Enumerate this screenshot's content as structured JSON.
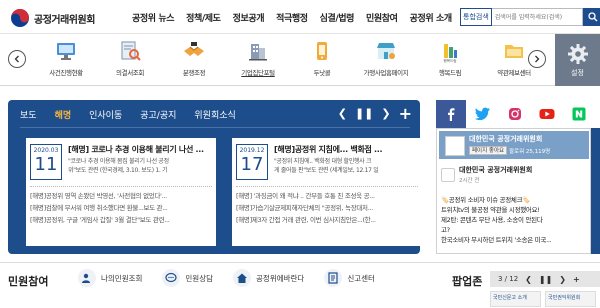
{
  "header": {
    "logo_text": "공정거래위원회",
    "nav": [
      "공정위 뉴스",
      "정책/제도",
      "정보공개",
      "적극행정",
      "심결/법령",
      "민원참여",
      "공정위 소개"
    ],
    "search_scope": "통합검색",
    "search_placeholder": "검색어를 입력하세요(검색)"
  },
  "quick_menu": {
    "items": [
      {
        "label": "사건진행현황",
        "icon": "monitor-icon"
      },
      {
        "label": "의결서조회",
        "icon": "document-search-icon"
      },
      {
        "label": "분쟁조정",
        "icon": "handshake-icon"
      },
      {
        "label": "기업집단포털",
        "icon": "building-icon"
      },
      {
        "label": "두낫콜",
        "icon": "phone-block-icon"
      },
      {
        "label": "가맹사업홈페이지",
        "icon": "shop-icon"
      },
      {
        "label": "행복드림",
        "icon": "happy-dream-icon"
      },
      {
        "label": "약관제보센터",
        "icon": "folder-icon"
      }
    ],
    "settings_label": "설정"
  },
  "board": {
    "tabs": [
      "보도",
      "해명",
      "인사이동",
      "공고/공지",
      "위원회소식"
    ],
    "active_tab": "해명",
    "cards": [
      {
        "ym": "2020.03",
        "day": "11",
        "title": "[해명] 코로나 추경 이용해 불리기 나선 ...",
        "desc1": "\"코로나 추경 이용해 몸집 불리기 나선 공정",
        "desc2": "위\"보도 관련 (한국경제, 3.10. 보도) 1. 기",
        "list": [
          "[해명]공정위 영역 손봤던 박영선, '사전협의 없었다'...",
          "[해명]검찰에 무서워 여행 취소했다면 환불...보도 관...",
          "[해명]공정위, 구글 '게임사 갑질' 3월 결단\"보도 관련..."
        ]
      },
      {
        "ym": "2019.12",
        "day": "17",
        "title": "[해명]공정위 지침에... 백화점 ...",
        "desc1": "\"공정위 지침에.. 백화점 대형 할인행사 크",
        "desc2": "게 줄어들 판\"보도 관련 (세계일보, 12.17 일",
        "list": [
          "[해명] '과징금이 왜 적냐 .. 간부들 호통 친 조성욱 공...",
          "[해명]가습기살균제피해자단체의 \"공정위, 녹장대처...",
          "[해명]제3자 간접 거래 관련, 이번 심사지침안은...(한..."
        ]
      }
    ]
  },
  "sns": {
    "tabs": [
      "facebook-icon",
      "twitter-icon",
      "instagram-icon",
      "youtube-icon",
      "naver-blog-icon"
    ],
    "page_name": "대한민국 공정거래위원회",
    "like_label": "페이지 좋아요",
    "followers": "팔로워 25,119명",
    "post_author": "대한민국 공정거래위원회",
    "post_time": "2시간 전",
    "post_lines": [
      "🏷️공정위 소비자 이슈 공정체크🏷️",
      "트위치tv의 불공정 약관을 시정했어요!",
      "제2탄: 콘텐츠 무단 사용, 소송이 안된다",
      "고?",
      "한국소비자 무시하던 트위치 '소송은 미국..."
    ]
  },
  "civil": {
    "title": "민원참여",
    "items": [
      {
        "label": "나의민원조회",
        "icon": "person-search-icon"
      },
      {
        "label": "민원상담",
        "icon": "chat-icon"
      },
      {
        "label": "공정위에바란다",
        "icon": "house-icon"
      },
      {
        "label": "신고센터",
        "icon": "report-icon"
      }
    ]
  },
  "popup_zone": {
    "title": "팝업존",
    "count": "3 / 12",
    "thumbs": [
      "국민신문고 소개",
      "국민권익위원회"
    ]
  },
  "colors": {
    "primary": "#1e4d8c",
    "accent": "#f5b53e",
    "settings_bg": "#6c7a8c"
  }
}
